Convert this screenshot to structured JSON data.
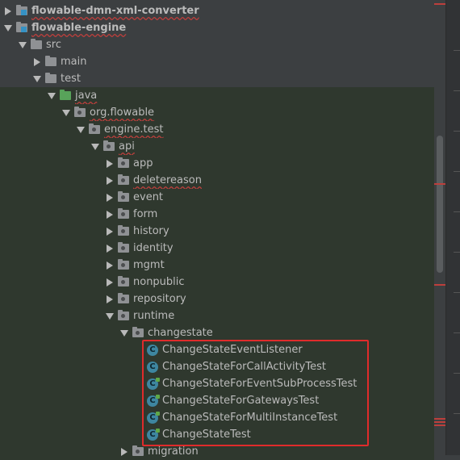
{
  "tree": {
    "rows": [
      {
        "label": "flowable-dmn-xml-converter",
        "depth": 0,
        "expanded": false,
        "icon": "module-folder-icon",
        "bold": true,
        "highlight": false
      },
      {
        "label": "flowable-engine",
        "depth": 0,
        "expanded": true,
        "icon": "module-folder-icon",
        "bold": true,
        "highlight": false
      },
      {
        "label": "src",
        "depth": 1,
        "expanded": true,
        "icon": "folder-icon",
        "highlight": false
      },
      {
        "label": "main",
        "depth": 2,
        "expanded": false,
        "icon": "folder-icon",
        "highlight": false
      },
      {
        "label": "test",
        "depth": 2,
        "expanded": true,
        "icon": "folder-icon",
        "highlight": false
      },
      {
        "label": "java",
        "depth": 3,
        "expanded": true,
        "icon": "source-root-icon",
        "highlight": true
      },
      {
        "label": "org.flowable",
        "depth": 4,
        "expanded": true,
        "icon": "package-icon",
        "highlight": true
      },
      {
        "label": "engine.test",
        "depth": 5,
        "expanded": true,
        "icon": "package-icon",
        "highlight": true
      },
      {
        "label": "api",
        "depth": 6,
        "expanded": true,
        "icon": "package-icon",
        "highlight": true
      },
      {
        "label": "app",
        "depth": 7,
        "expanded": false,
        "icon": "package-icon",
        "highlight": true
      },
      {
        "label": "deletereason",
        "depth": 7,
        "expanded": false,
        "icon": "package-icon",
        "highlight": true
      },
      {
        "label": "event",
        "depth": 7,
        "expanded": false,
        "icon": "package-icon",
        "highlight": true
      },
      {
        "label": "form",
        "depth": 7,
        "expanded": false,
        "icon": "package-icon",
        "highlight": true
      },
      {
        "label": "history",
        "depth": 7,
        "expanded": false,
        "icon": "package-icon",
        "highlight": true
      },
      {
        "label": "identity",
        "depth": 7,
        "expanded": false,
        "icon": "package-icon",
        "highlight": true
      },
      {
        "label": "mgmt",
        "depth": 7,
        "expanded": false,
        "icon": "package-icon",
        "highlight": true
      },
      {
        "label": "nonpublic",
        "depth": 7,
        "expanded": false,
        "icon": "package-icon",
        "highlight": true
      },
      {
        "label": "repository",
        "depth": 7,
        "expanded": false,
        "icon": "package-icon",
        "highlight": true
      },
      {
        "label": "runtime",
        "depth": 7,
        "expanded": true,
        "icon": "package-icon",
        "highlight": true
      },
      {
        "label": "changestate",
        "depth": 8,
        "expanded": true,
        "icon": "package-icon",
        "highlight": true
      },
      {
        "label": "ChangeStateEventListener",
        "depth": 9,
        "icon": "class-icon",
        "highlight": true
      },
      {
        "label": "ChangeStateForCallActivityTest",
        "depth": 9,
        "icon": "class-icon",
        "highlight": true
      },
      {
        "label": "ChangeStateForEventSubProcessTest",
        "depth": 9,
        "icon": "test-class-icon",
        "highlight": true
      },
      {
        "label": "ChangeStateForGatewaysTest",
        "depth": 9,
        "icon": "test-class-icon",
        "highlight": true
      },
      {
        "label": "ChangeStateForMultiInstanceTest",
        "depth": 9,
        "icon": "test-class-icon",
        "highlight": true
      },
      {
        "label": "ChangeStateTest",
        "depth": 9,
        "icon": "test-class-icon",
        "highlight": true
      },
      {
        "label": "migration",
        "depth": 8,
        "expanded": false,
        "icon": "package-icon",
        "highlight": true
      }
    ]
  },
  "colors": {
    "background": "#3c3f41",
    "highlight": "#2f382e",
    "selection_box": "#e02b2b",
    "error_underline": "#bc3f3c"
  }
}
